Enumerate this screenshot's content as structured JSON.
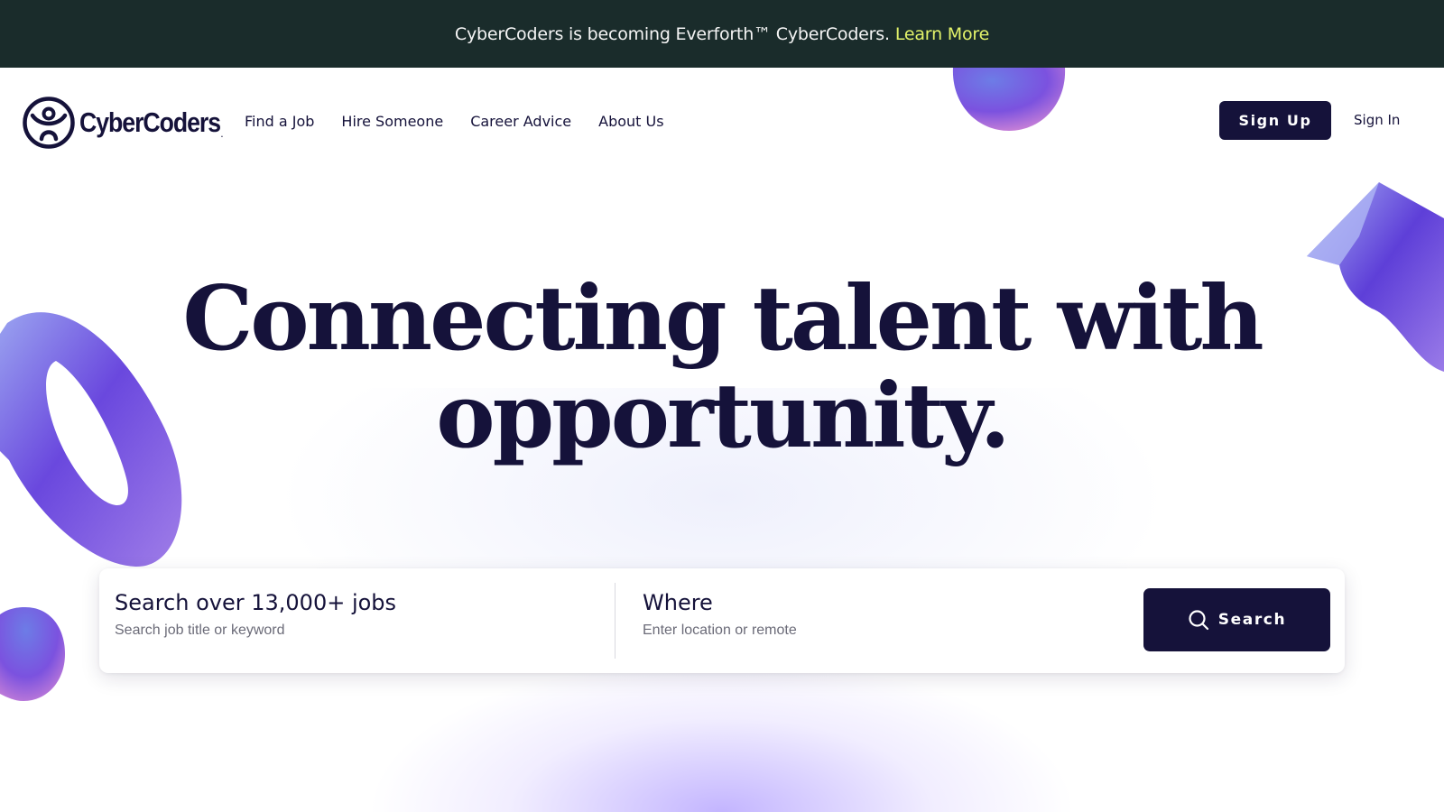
{
  "announcement": {
    "text": "CyberCoders is becoming Everforth™ CyberCoders.",
    "link_label": "Learn More"
  },
  "header": {
    "logo_text": "CyberCoders",
    "logo_mark": ".",
    "nav": [
      {
        "label": "Find a Job"
      },
      {
        "label": "Hire Someone"
      },
      {
        "label": "Career Advice"
      },
      {
        "label": "About Us"
      }
    ],
    "signup_label": "Sign Up",
    "signin_label": "Sign In"
  },
  "hero": {
    "headline_line1": "Connecting talent with",
    "headline_line2": "opportunity."
  },
  "search": {
    "keyword_label": "Search over 13,000+ jobs",
    "keyword_placeholder": "Search job title or keyword",
    "location_label": "Where",
    "location_placeholder": "Enter location or remote",
    "button_label": "Search",
    "button_icon": "search-icon"
  },
  "colors": {
    "brand_dark": "#15123a",
    "announce_bg": "#1a2c2b",
    "link_accent": "#e3f36a",
    "shape_purple": "#7b5ce8"
  }
}
